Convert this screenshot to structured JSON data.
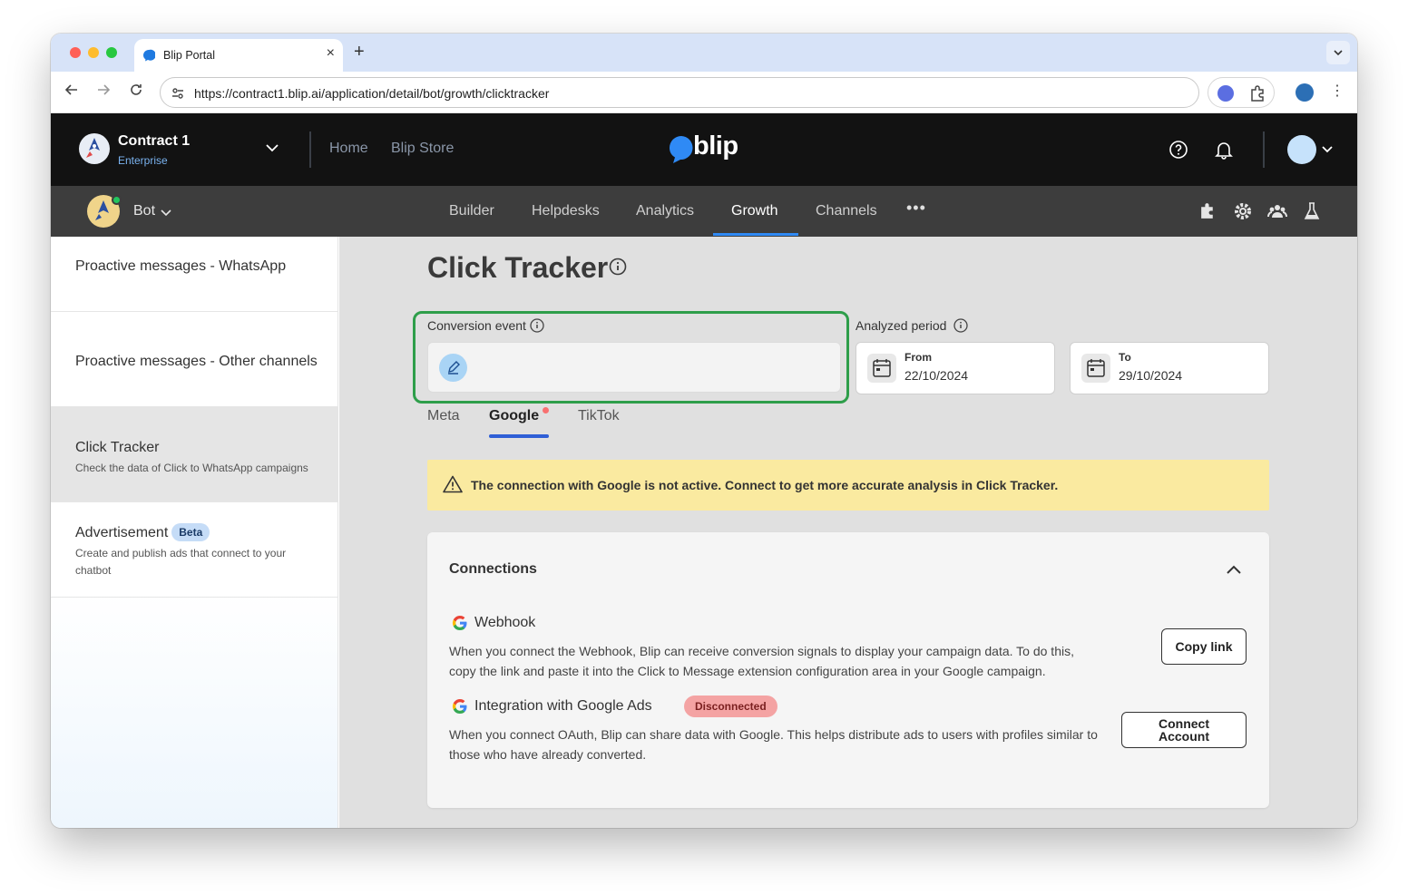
{
  "browser": {
    "tab_title": "Blip Portal",
    "tab_close": "×",
    "new_tab": "+",
    "url": "https://contract1.blip.ai/application/detail/bot/growth/clicktracker"
  },
  "header": {
    "contract_name": "Contract 1",
    "contract_plan": "Enterprise",
    "links": [
      "Home",
      "Blip Store"
    ],
    "logo_text": "blip"
  },
  "subnav": {
    "bot_label": "Bot",
    "tabs": [
      "Builder",
      "Helpdesks",
      "Analytics",
      "Growth",
      "Channels"
    ],
    "active_tab": "Growth",
    "more": "•••"
  },
  "sidebar": {
    "items": [
      {
        "title": "Proactive messages - WhatsApp",
        "description": ""
      },
      {
        "title": "Proactive messages - Other channels",
        "description": ""
      },
      {
        "title": "Click Tracker",
        "description": "Check the data of Click to WhatsApp campaigns"
      },
      {
        "title": "Advertisement",
        "badge": "Beta",
        "description": "Create and publish ads that connect to your chatbot"
      }
    ]
  },
  "main": {
    "page_title": "Click Tracker",
    "conversion_event_label": "Conversion event",
    "analyzed_period_label": "Analyzed period",
    "from_label": "From",
    "from_value": "22/10/2024",
    "to_label": "To",
    "to_value": "29/10/2024",
    "tabs": [
      "Meta",
      "Google",
      "TikTok"
    ],
    "active_tab": "Google",
    "alert_text": "The connection with Google is not active. Connect to get more accurate analysis in Click Tracker.",
    "connections": {
      "title": "Connections",
      "webhook": {
        "name": "Webhook",
        "description": "When you connect the Webhook, Blip can receive conversion signals to display your campaign data. To do this, copy the link and paste it into the Click to Message extension configuration area in your Google campaign.",
        "button": "Copy link"
      },
      "google_ads": {
        "name": "Integration with Google Ads",
        "status": "Disconnected",
        "description": "When you connect OAuth, Blip can share data with Google. This helps distribute ads to users with profiles similar to those who have already converted.",
        "button": "Connect Account"
      }
    }
  },
  "colors": {
    "header_bg": "#121212",
    "subnav_bg": "#3d3d3d",
    "accent_blue": "#2f8af5",
    "conversion_frame": "#2e9e4a",
    "alert_bg": "#faeaa0",
    "status_disconnected": "#f4a3a3"
  }
}
